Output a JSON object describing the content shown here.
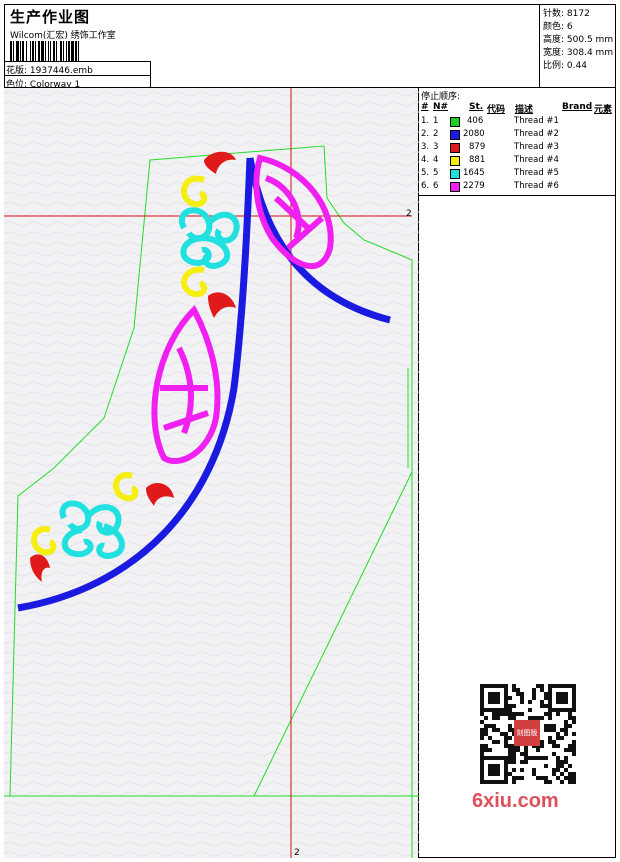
{
  "header": {
    "title": "生产作业图",
    "subtitle": "Wilcom(汇宏) 绣饰工作室",
    "design_label": "花版:",
    "design_value": "1937446.emb",
    "colorway_label": "色位:",
    "colorway_value": "Colorway 1"
  },
  "stats": [
    {
      "label": "针数:",
      "value": "8172"
    },
    {
      "label": "颜色:",
      "value": "6"
    },
    {
      "label": "高度:",
      "value": "500.5 mm"
    },
    {
      "label": "宽度:",
      "value": "308.4 mm"
    },
    {
      "label": "比例:",
      "value": "0.44"
    }
  ],
  "stop_sequence": {
    "title": "停止顺序:",
    "columns": {
      "num": "#",
      "n": "N#",
      "st": "St.",
      "code": "代码",
      "desc": "描述",
      "brand": "Brand",
      "element": "元素"
    },
    "rows": [
      {
        "idx": "1.",
        "n": "1",
        "color": "#22cc22",
        "st": "406",
        "desc": "Thread #1"
      },
      {
        "idx": "2.",
        "n": "2",
        "color": "#1a1ae0",
        "st": "2080",
        "desc": "Thread #2"
      },
      {
        "idx": "3.",
        "n": "3",
        "color": "#e01a1a",
        "st": "879",
        "desc": "Thread #3"
      },
      {
        "idx": "4.",
        "n": "4",
        "color": "#f5ee10",
        "st": "881",
        "desc": "Thread #4"
      },
      {
        "idx": "5.",
        "n": "5",
        "color": "#20e0e0",
        "st": "1645",
        "desc": "Thread #5"
      },
      {
        "idx": "6.",
        "n": "6",
        "color": "#f020f0",
        "st": "2279",
        "desc": "Thread #6"
      }
    ]
  },
  "canvas": {
    "guide_label_top": "2",
    "guide_label_bottom": "2"
  },
  "colors": {
    "outline": "#22dd22",
    "guide": "#d01010",
    "blue": "#1a1ae0",
    "magenta": "#f020f0",
    "cyan": "#20e0e0",
    "yellow": "#f5ee10",
    "red": "#e01a1a"
  },
  "watermark": "6xiu.com",
  "stamp_text": "刻图版"
}
